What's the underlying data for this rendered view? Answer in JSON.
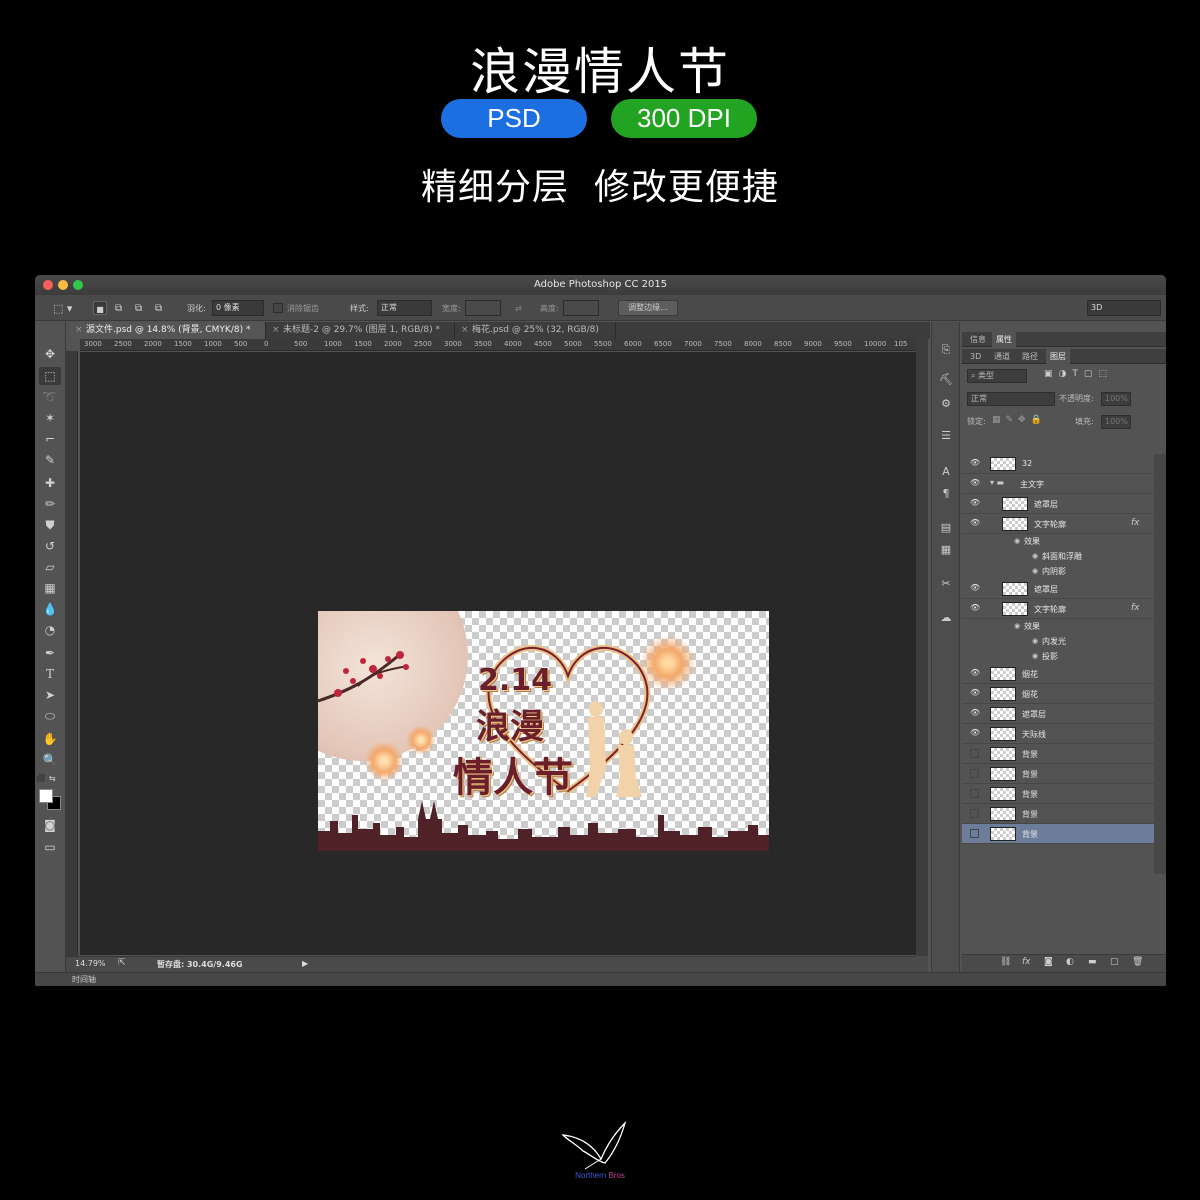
{
  "hero": {
    "title": "浪漫情人节",
    "badges": [
      {
        "label": "PSD",
        "color": "#1c6fe0"
      },
      {
        "label": "300 DPI",
        "color": "#22a322"
      }
    ],
    "tagline": "精细分层  修改更便捷"
  },
  "window": {
    "title": "Adobe Photoshop CC 2015",
    "traffic_lights": [
      "#fc605c",
      "#fdbc40",
      "#34c84a"
    ]
  },
  "options_bar": {
    "feather_label": "羽化:",
    "feather_value": "0 像素",
    "antialias_label": "消除锯齿",
    "style_label": "样式:",
    "style_value": "正常",
    "width_label": "宽度:",
    "height_label": "高度:",
    "refine_edge_button": "调整边缘...",
    "workspace_value": "3D"
  },
  "tabs": [
    {
      "label": "源文件.psd @ 14.8% (背景, CMYK/8) *",
      "active": true
    },
    {
      "label": "未标题-2 @ 29.7% (图层 1, RGB/8) *",
      "active": false
    },
    {
      "label": "梅花.psd @ 25% (32, RGB/8)",
      "active": false
    }
  ],
  "ruler": {
    "ticks": [
      "3000",
      "2500",
      "2000",
      "1500",
      "1000",
      "500",
      "0",
      "500",
      "1000",
      "1500",
      "2000",
      "2500",
      "3000",
      "3500",
      "4000",
      "4500",
      "5000",
      "5500",
      "6000",
      "6500",
      "7000",
      "7500",
      "8000",
      "8500",
      "9000",
      "9500",
      "10000",
      "105"
    ]
  },
  "artwork": {
    "date": "2.14",
    "line1": "浪漫",
    "line2": "情人节"
  },
  "status": {
    "zoom": "14.79%",
    "scratch": "暂存盘: 30.4G/9.46G",
    "timeline_label": "时间轴"
  },
  "panel": {
    "top_tabs": [
      "信息",
      "属性"
    ],
    "tabs": [
      "3D",
      "通道",
      "路径",
      "图层"
    ],
    "filter_kind": "类型",
    "blend_mode": "正常",
    "opacity_label": "不透明度:",
    "opacity_value": "100%",
    "lock_label": "锁定:",
    "fill_label": "填充:",
    "fill_value": "100%"
  },
  "layers": [
    {
      "name": "32",
      "visible": true
    },
    {
      "name": "主文字",
      "visible": true,
      "group": true
    },
    {
      "name": "遮罩层",
      "visible": true
    },
    {
      "name": "文字轮廓",
      "visible": true,
      "fx": "fx"
    },
    {
      "name": "效果",
      "sub": true
    },
    {
      "name": "斜面和浮雕",
      "sub": true
    },
    {
      "name": "内阴影",
      "sub": true
    },
    {
      "name": "遮罩层",
      "visible": true
    },
    {
      "name": "文字轮廓",
      "visible": true,
      "fx": "fx"
    },
    {
      "name": "效果",
      "sub": true
    },
    {
      "name": "内发光",
      "sub": true
    },
    {
      "name": "投影",
      "sub": true
    },
    {
      "name": "烟花",
      "visible": true
    },
    {
      "name": "烟花",
      "visible": true
    },
    {
      "name": "遮罩层",
      "visible": true
    },
    {
      "name": "天际线",
      "visible": true
    },
    {
      "name": "背景",
      "visible": false
    },
    {
      "name": "背景",
      "visible": false
    },
    {
      "name": "背景",
      "visible": false
    },
    {
      "name": "背景",
      "visible": false
    },
    {
      "name": "背景",
      "visible": false,
      "selected": true
    }
  ],
  "logo": {
    "text_a": "Northern",
    "text_b": "Bros",
    "color_a": "#3a5bd9",
    "color_b": "#c03f8f"
  }
}
